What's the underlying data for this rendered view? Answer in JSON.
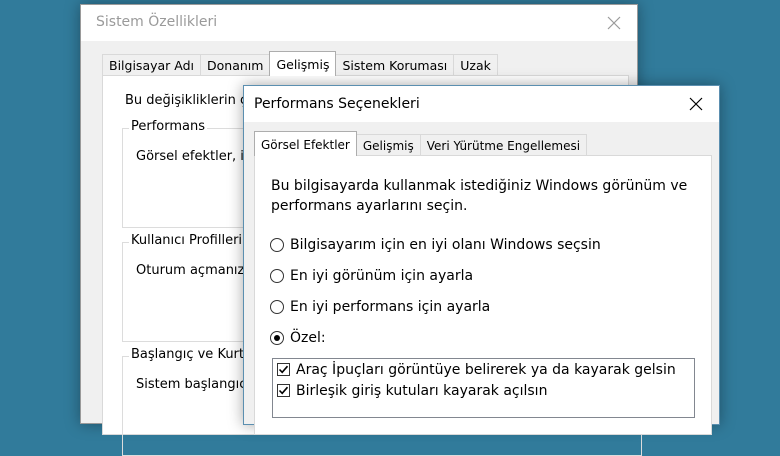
{
  "background_window": {
    "title": "Sistem Özellikleri",
    "tabs": [
      "Bilgisayar Adı",
      "Donanım",
      "Gelişmiş",
      "Sistem Koruması",
      "Uzak"
    ],
    "active_tab": "Gelişmiş",
    "intro": "Bu değişikliklerin ço",
    "groups": [
      {
        "label": "Performans",
        "text": "Görsel efektler, işle"
      },
      {
        "label": "Kullanıcı Profilleri",
        "text": "Oturum açmanızla"
      },
      {
        "label": "Başlangıç ve Kurtar",
        "text": "Sistem başlangıcı,"
      }
    ]
  },
  "dialog": {
    "title": "Performans Seçenekleri",
    "tabs": [
      "Görsel Efektler",
      "Gelişmiş",
      "Veri Yürütme Engellemesi"
    ],
    "active_tab": "Görsel Efektler",
    "intro": "Bu bilgisayarda kullanmak istediğiniz Windows görünüm ve performans ayarlarını seçin.",
    "options": [
      {
        "label": "Bilgisayarım için en iyi olanı Windows seçsin",
        "checked": false
      },
      {
        "label": "En iyi görünüm için ayarla",
        "checked": false
      },
      {
        "label": "En iyi performans için ayarla",
        "checked": false
      },
      {
        "label": "Özel:",
        "checked": true
      }
    ],
    "effects": [
      {
        "label": "Araç İpuçları görüntüye belirerek ya da kayarak gelsin",
        "checked": true
      },
      {
        "label": "Birleşik giriş kutuları kayarak açılsın",
        "checked": true
      }
    ]
  },
  "colors": {
    "desktop": "#317b9b",
    "window": "#f0f0f0"
  }
}
